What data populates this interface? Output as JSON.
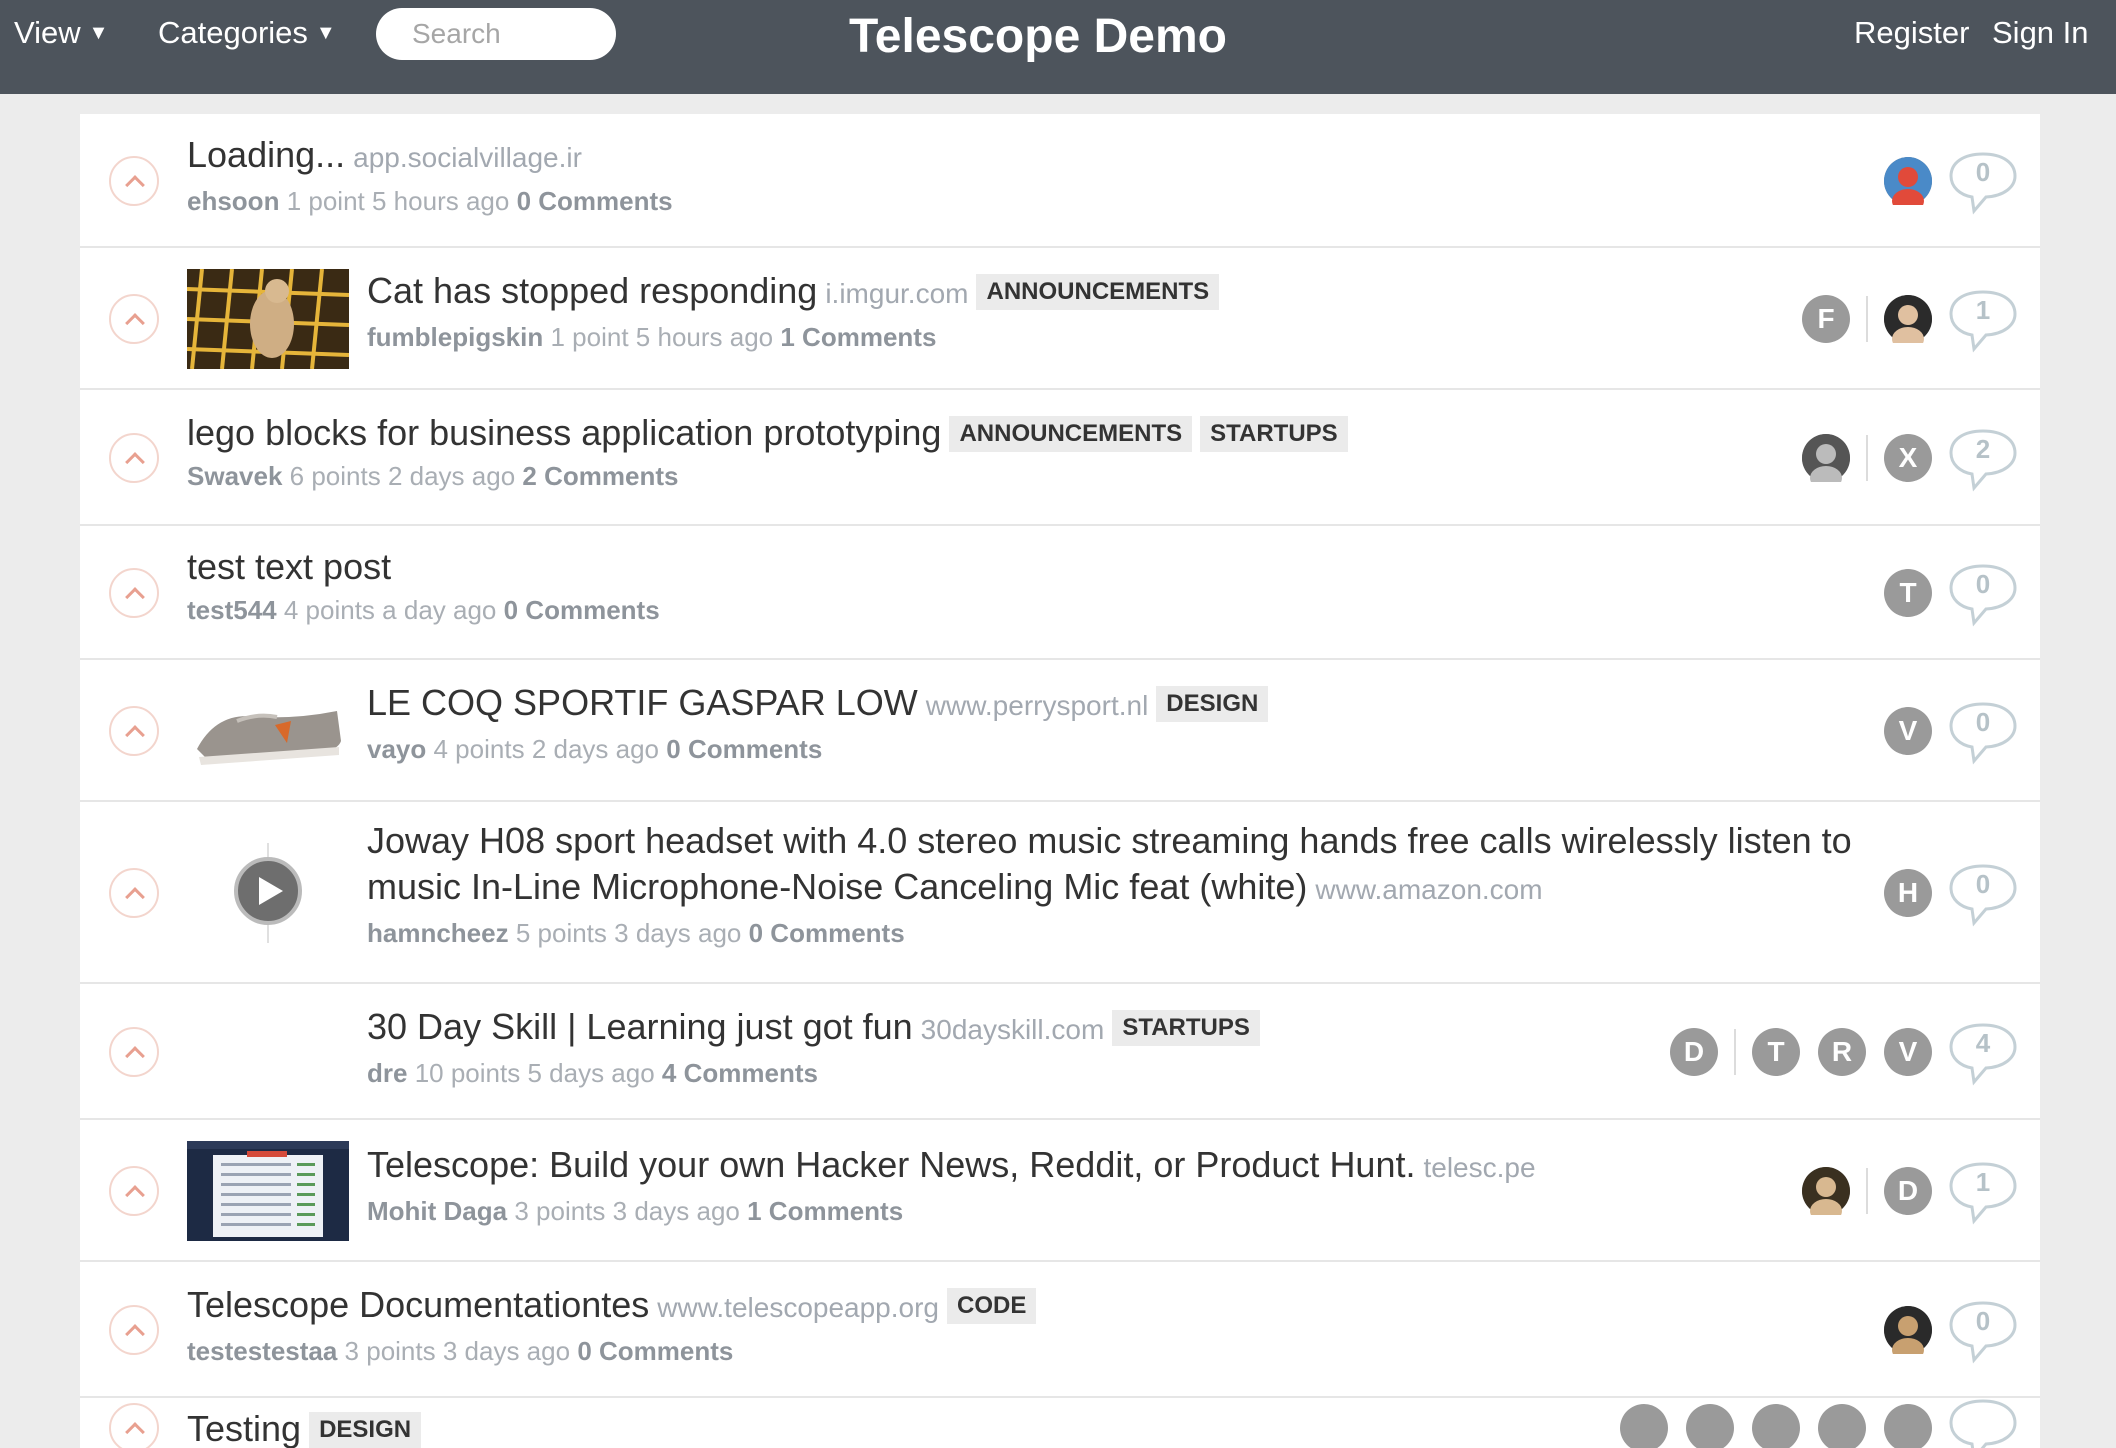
{
  "header": {
    "view_label": "View",
    "categories_label": "Categories",
    "search_placeholder": "Search",
    "site_title": "Telescope Demo",
    "register_label": "Register",
    "signin_label": "Sign In"
  },
  "posts": [
    {
      "rank": "1",
      "title": "Loading...",
      "domain": "app.socialvillage.ir",
      "categories": [],
      "author": "ehsoon",
      "points": "1 point",
      "time": "5 hours ago",
      "comments": "0 Comments",
      "thumbnail": "none",
      "avatars": [
        {
          "type": "photo",
          "letter": ""
        }
      ],
      "comment_count": "0"
    },
    {
      "rank": "2",
      "title": "Cat has stopped responding",
      "domain": "i.imgur.com",
      "categories": [
        "ANNOUNCEMENTS"
      ],
      "author": "fumblepigskin",
      "points": "1 point",
      "time": "5 hours ago",
      "comments": "1 Comments",
      "thumbnail": "cat-photo",
      "avatars": [
        {
          "type": "letter",
          "letter": "F"
        },
        {
          "type": "sep"
        },
        {
          "type": "photo",
          "letter": ""
        }
      ],
      "comment_count": "1"
    },
    {
      "rank": "3",
      "title": "lego blocks for business application prototyping",
      "domain": "",
      "categories": [
        "ANNOUNCEMENTS",
        "STARTUPS"
      ],
      "author": "Swavek",
      "points": "6 points",
      "time": "2 days ago",
      "comments": "2 Comments",
      "thumbnail": "none",
      "avatars": [
        {
          "type": "photo",
          "letter": ""
        },
        {
          "type": "sep"
        },
        {
          "type": "letter",
          "letter": "X"
        }
      ],
      "comment_count": "2"
    },
    {
      "rank": "4",
      "title": "test text post",
      "domain": "",
      "categories": [],
      "author": "test544",
      "points": "4 points",
      "time": "a day ago",
      "comments": "0 Comments",
      "thumbnail": "none",
      "avatars": [
        {
          "type": "letter",
          "letter": "T"
        }
      ],
      "comment_count": "0"
    },
    {
      "rank": "5",
      "title": "LE COQ SPORTIF GASPAR LOW",
      "domain": "www.perrysport.nl",
      "categories": [
        "DESIGN"
      ],
      "author": "vayo",
      "points": "4 points",
      "time": "2 days ago",
      "comments": "0 Comments",
      "thumbnail": "shoe-photo",
      "avatars": [
        {
          "type": "letter",
          "letter": "V"
        }
      ],
      "comment_count": "0"
    },
    {
      "rank": "6",
      "title": "Joway H08 sport headset with 4.0 stereo music streaming hands free calls wirelessly listen to music In-Line Microphone-Noise Canceling Mic feat (white)",
      "domain": "www.amazon.com",
      "categories": [],
      "author": "hamncheez",
      "points": "5 points",
      "time": "3 days ago",
      "comments": "0 Comments",
      "thumbnail": "video-play",
      "avatars": [
        {
          "type": "letter",
          "letter": "H"
        }
      ],
      "comment_count": "0"
    },
    {
      "rank": "7",
      "title": "30 Day Skill | Learning just got fun",
      "domain": "30dayskill.com",
      "categories": [
        "STARTUPS"
      ],
      "author": "dre",
      "points": "10 points",
      "time": "5 days ago",
      "comments": "4 Comments",
      "thumbnail": "blank",
      "avatars": [
        {
          "type": "letter",
          "letter": "D"
        },
        {
          "type": "sep"
        },
        {
          "type": "letter",
          "letter": "T"
        },
        {
          "type": "letter",
          "letter": "R"
        },
        {
          "type": "letter",
          "letter": "V"
        }
      ],
      "comment_count": "4"
    },
    {
      "rank": "8",
      "title": "Telescope: Build your own Hacker News, Reddit, or Product Hunt.",
      "domain": "telesc.pe",
      "categories": [],
      "author": "Mohit Daga",
      "points": "3 points",
      "time": "3 days ago",
      "comments": "1 Comments",
      "thumbnail": "screenshot",
      "avatars": [
        {
          "type": "photo",
          "letter": ""
        },
        {
          "type": "sep"
        },
        {
          "type": "letter",
          "letter": "D"
        }
      ],
      "comment_count": "1"
    },
    {
      "rank": "9",
      "title": "Telescope Documentationtes",
      "domain": "www.telescopeapp.org",
      "categories": [
        "CODE"
      ],
      "author": "testestestaa",
      "points": "3 points",
      "time": "3 days ago",
      "comments": "0 Comments",
      "thumbnail": "none",
      "avatars": [
        {
          "type": "photo",
          "letter": ""
        }
      ],
      "comment_count": "0"
    },
    {
      "rank": "10",
      "title": "Testing",
      "domain": "",
      "categories": [
        "DESIGN"
      ],
      "author": "",
      "points": "",
      "time": "",
      "comments": "",
      "thumbnail": "none",
      "avatars": [
        {
          "type": "letter",
          "letter": ""
        },
        {
          "type": "letter",
          "letter": ""
        },
        {
          "type": "letter",
          "letter": ""
        },
        {
          "type": "letter",
          "letter": ""
        },
        {
          "type": "letter",
          "letter": ""
        }
      ],
      "comment_count": ""
    }
  ],
  "colors": {
    "header_bg": "#4d545c",
    "page_bg": "#ececec",
    "upvote_accent": "#e8a090",
    "meta_text": "#a9aeb4"
  }
}
